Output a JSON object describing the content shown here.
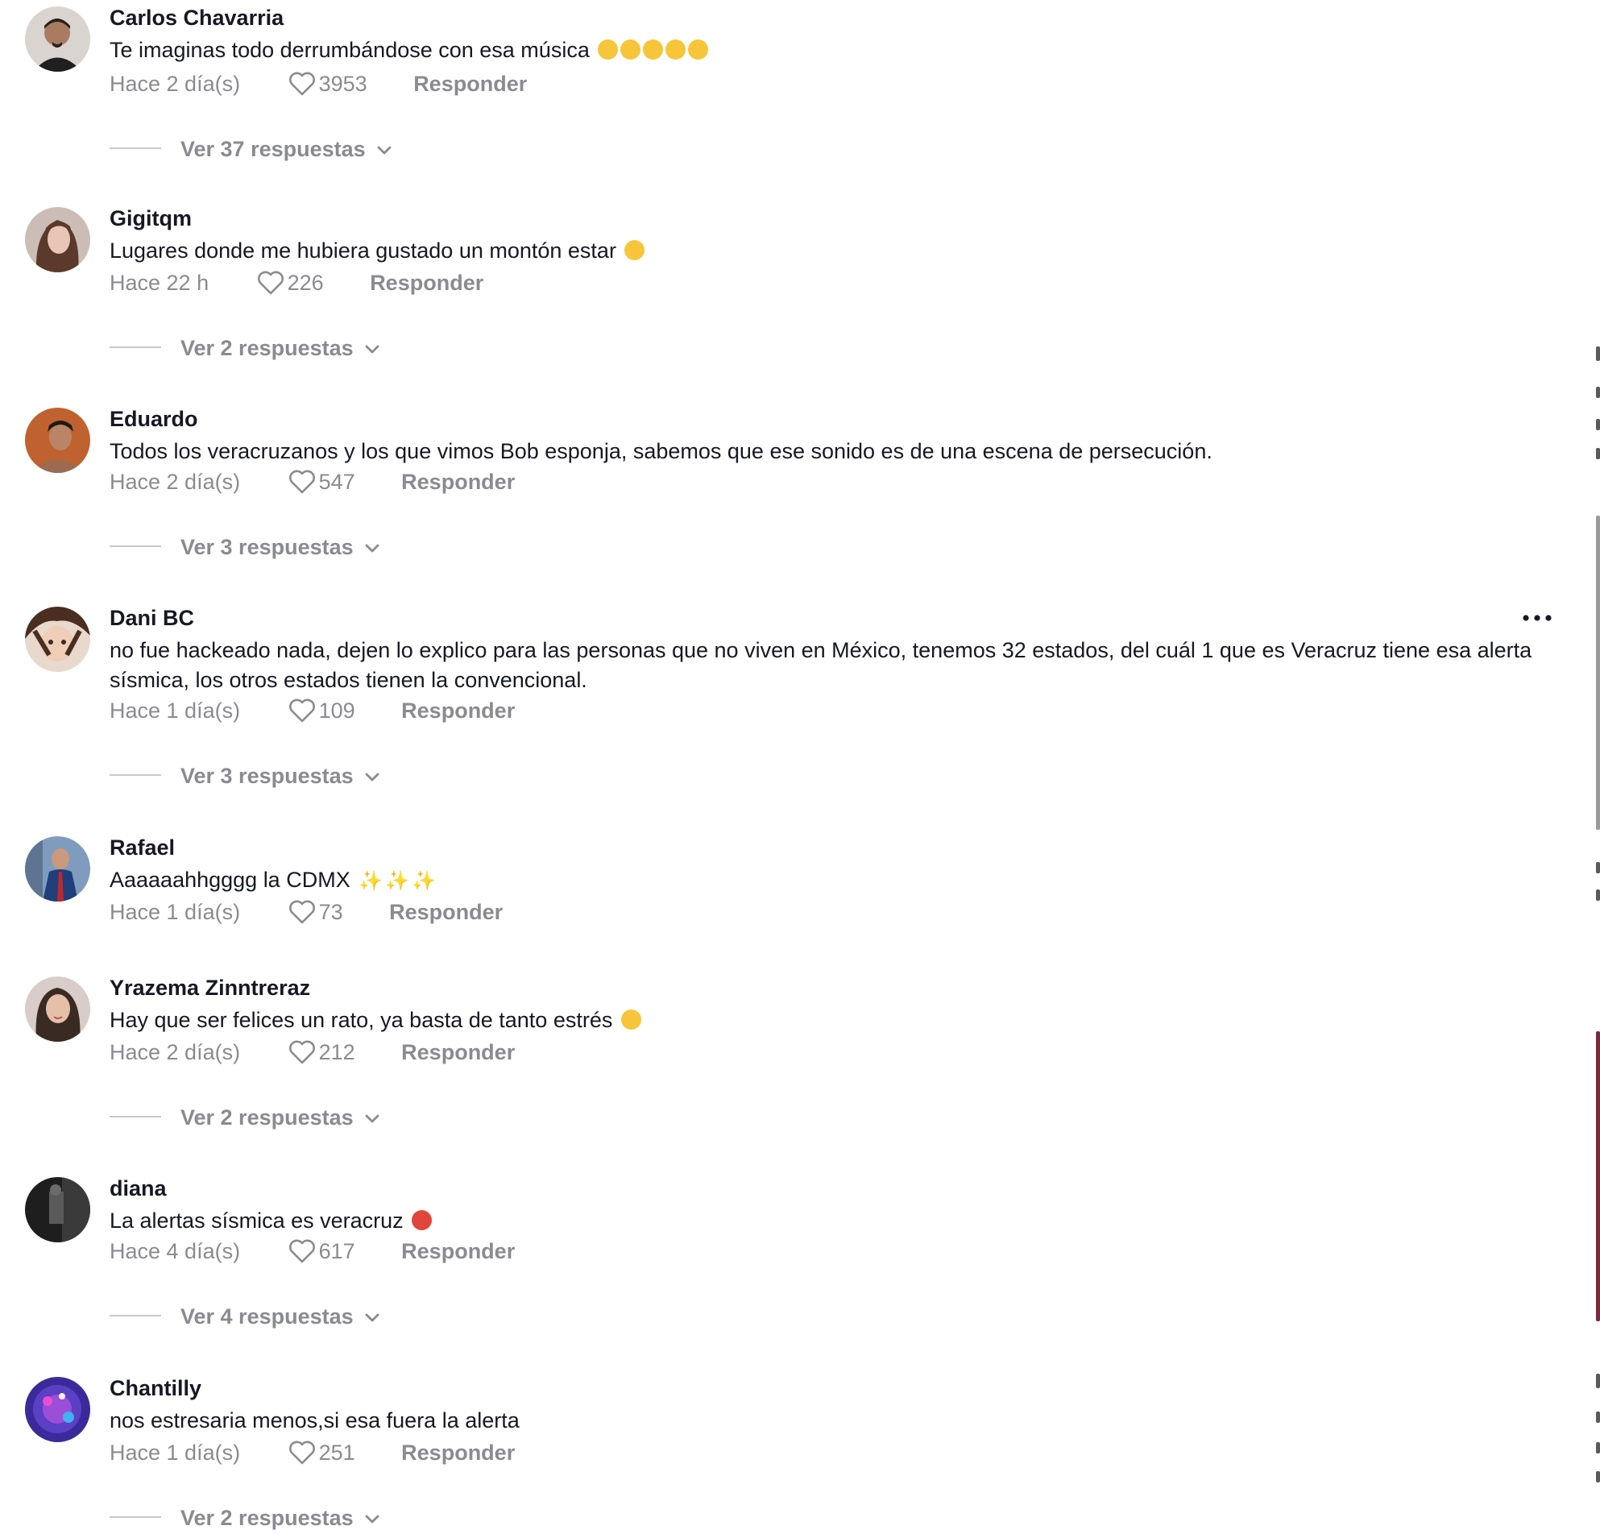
{
  "comments": [
    {
      "username": "Carlos Chavarria",
      "text": "Te imaginas todo derrumbándose con esa música",
      "emojis": [
        "joy",
        "joy",
        "joy",
        "joy",
        "joy"
      ],
      "time": "Hace 2 día(s)",
      "likes": "3953",
      "reply_label": "Responder",
      "replies_label": "Ver 37 respuestas",
      "avatar_color": "#6b5a4c"
    },
    {
      "username": "Gigitqm",
      "text": "Lugares donde me hubiera gustado un montón estar",
      "emojis": [
        "sob"
      ],
      "time": "Hace 22 h",
      "likes": "226",
      "reply_label": "Responder",
      "replies_label": "Ver 2 respuestas",
      "avatar_color": "#8a6f63"
    },
    {
      "username": "Eduardo",
      "text": "Todos los veracruzanos y los que vimos Bob esponja, sabemos que ese sonido es de una escena de persecución.",
      "emojis": [],
      "time": "Hace 2 día(s)",
      "likes": "547",
      "reply_label": "Responder",
      "replies_label": "Ver 3 respuestas",
      "avatar_color": "#b0582c"
    },
    {
      "username": "Dani BC",
      "text": "no fue hackeado nada, dejen lo explico para las personas que no viven en México, tenemos 32 estados, del cuál 1 que es Veracruz tiene esa alerta sísmica, los otros estados tienen la convencional.",
      "emojis": [],
      "time": "Hace 1 día(s)",
      "likes": "109",
      "reply_label": "Responder",
      "replies_label": "Ver 3 respuestas",
      "avatar_color": "#7a5a44"
    },
    {
      "username": "Rafael",
      "text": "Aaaaaahhgggg la CDMX",
      "emojis": [
        "sparkles",
        "sparkles",
        "sparkles"
      ],
      "time": "Hace 1 día(s)",
      "likes": "73",
      "reply_label": "Responder",
      "replies_label": "",
      "avatar_color": "#3a5a8a"
    },
    {
      "username": "Yrazema Zinntreraz",
      "text": "Hay que ser felices un rato, ya basta de tanto estrés",
      "emojis": [
        "joy"
      ],
      "time": "Hace 2 día(s)",
      "likes": "212",
      "reply_label": "Responder",
      "replies_label": "Ver 2 respuestas",
      "avatar_color": "#c49a86"
    },
    {
      "username": "diana",
      "text": "La alertas sísmica es veracruz",
      "emojis": [
        "crab"
      ],
      "time": "Hace 4 día(s)",
      "likes": "617",
      "reply_label": "Responder",
      "replies_label": "Ver 4 respuestas",
      "avatar_color": "#2b2b2b"
    },
    {
      "username": "Chantilly",
      "text": "nos estresaria menos,si esa fuera la alerta",
      "emojis": [],
      "time": "Hace 1 día(s)",
      "likes": "251",
      "reply_label": "Responder",
      "replies_label": "Ver 2 respuestas",
      "avatar_color": "#5b3fc4"
    }
  ],
  "icons": {
    "like": "heart-outline-icon",
    "expand": "chevron-down-icon",
    "more": "more-horizontal-icon"
  },
  "colors": {
    "text_primary": "#161823",
    "text_secondary": "#8a8b91",
    "divider": "#c8c9cc"
  }
}
